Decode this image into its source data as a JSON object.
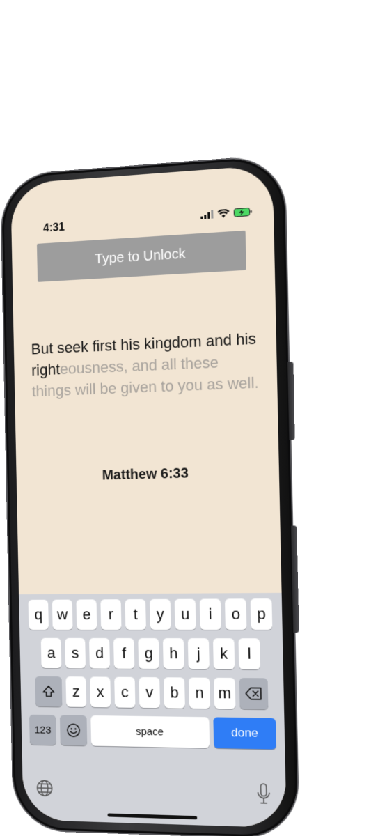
{
  "status_bar": {
    "time": "4:31"
  },
  "unlock": {
    "label": "Type to Unlock"
  },
  "verse": {
    "typed": "But seek first his kingdom and his right",
    "remaining": "eousness, and all these things will be given to you as well."
  },
  "reference": "Matthew 6:33",
  "keyboard": {
    "row1": [
      "q",
      "w",
      "e",
      "r",
      "t",
      "y",
      "u",
      "i",
      "o",
      "p"
    ],
    "row2": [
      "a",
      "s",
      "d",
      "f",
      "g",
      "h",
      "j",
      "k",
      "l"
    ],
    "row3": [
      "z",
      "x",
      "c",
      "v",
      "b",
      "n",
      "m"
    ],
    "numbers_label": "123",
    "space_label": "space",
    "done_label": "done"
  },
  "colors": {
    "screen_background": "#f2e5d3",
    "banner_background": "#9d9d9d",
    "typed_text": "#161616",
    "untyped_text": "#a8a39d",
    "done_key": "#2f7df6",
    "battery": "#4cd964"
  },
  "icons": {
    "signal": "cellular-signal-icon",
    "wifi": "wifi-icon",
    "battery": "battery-charging-icon",
    "shift": "shift-icon",
    "backspace": "backspace-icon",
    "emoji": "emoji-icon",
    "globe": "globe-icon",
    "microphone": "microphone-icon"
  }
}
